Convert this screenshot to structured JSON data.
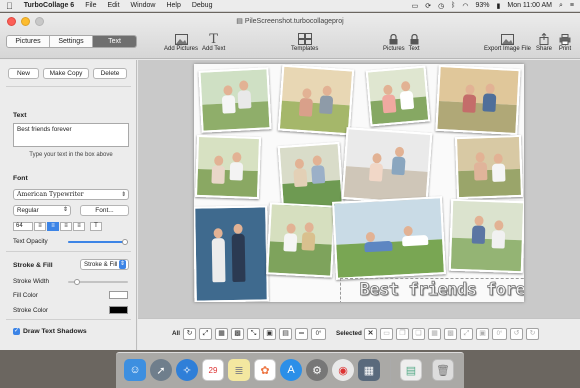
{
  "menubar": {
    "apple": "",
    "app_name": "TurboCollage 6",
    "menus": [
      "File",
      "Edit",
      "Window",
      "Help",
      "Debug"
    ],
    "battery": "93%",
    "clock": "Mon 11:00 AM"
  },
  "window": {
    "title": "PileScreenshot.turbocollageproj"
  },
  "sidebar_tabs": [
    {
      "label": "Pictures",
      "active": false
    },
    {
      "label": "Settings",
      "active": false
    },
    {
      "label": "Text",
      "active": true
    }
  ],
  "toolbar": {
    "add_pictures": "Add Pictures",
    "add_text": "Add Text",
    "templates": "Templates",
    "lock_pictures": "Pictures",
    "lock_text": "Text",
    "export": "Export Image File",
    "share": "Share",
    "print": "Print"
  },
  "text_panel": {
    "new_label": "New",
    "make_copy_label": "Make Copy",
    "delete_label": "Delete",
    "text_heading": "Text",
    "text_value": "Best friends forever",
    "text_hint": "Type your text in the box above",
    "font_heading": "Font",
    "font_family": "American Typewriter",
    "font_style": "Regular",
    "font_button": "Font...",
    "font_size": "64",
    "text_opacity_label": "Text Opacity",
    "stroke_fill_heading": "Stroke & Fill",
    "stroke_fill_mode": "Stroke & Fill",
    "stroke_width_label": "Stroke Width",
    "fill_color_label": "Fill Color",
    "stroke_color_label": "Stroke Color",
    "draw_shadows_label": "Draw Text Shadows",
    "text_opacity": 1.0,
    "stroke_width": 0.1,
    "fill_color": "#ffffff",
    "stroke_color": "#000000"
  },
  "canvas": {
    "caption": "Best friends forever"
  },
  "bottombar": {
    "all_label": "All",
    "all_rotation": "0°",
    "selected_label": "Selected",
    "selected_rotation": "0°"
  },
  "colors": {
    "accent": "#3c84e6",
    "active_tab": "#6f6f6f"
  }
}
